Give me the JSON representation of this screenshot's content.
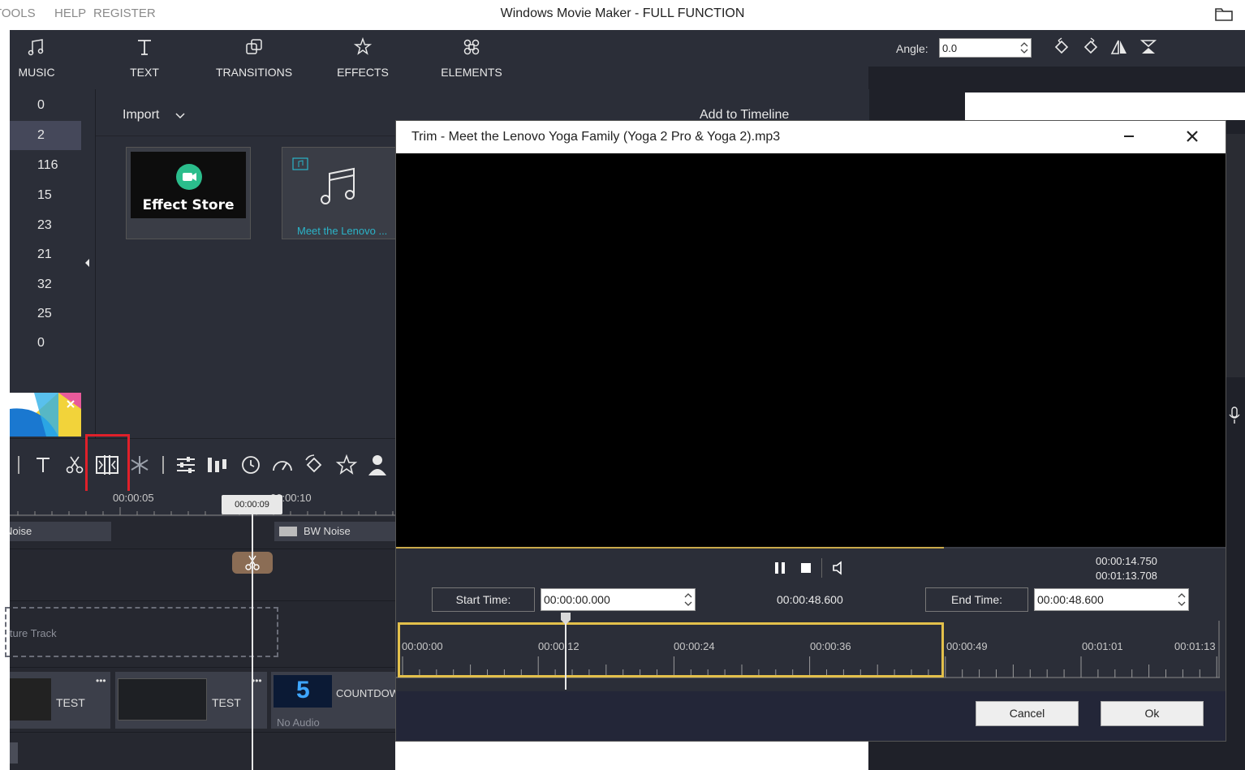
{
  "menu": {
    "tools": "TOOLS",
    "help": "HELP",
    "register": "REGISTER"
  },
  "app_title": "Windows Movie Maker - FULL FUNCTION",
  "toolbar": {
    "music": "MUSIC",
    "text": "TEXT",
    "transitions": "TRANSITIONS",
    "effects": "EFFECTS",
    "elements": "ELEMENTS"
  },
  "right_panel": {
    "angle_label": "Angle:",
    "angle_value": "0.0"
  },
  "sidebar_counts": [
    "0",
    "2",
    "116",
    "15",
    "23",
    "21",
    "32",
    "25",
    "0"
  ],
  "sidebar_selected_index": 1,
  "media": {
    "import_label": "Import",
    "add_to_timeline_label": "Add to Timeline",
    "effect_store_label": "Effect Store",
    "music_item_label": "Meet the Lenovo ..."
  },
  "timeline": {
    "ruler_labels": [
      "00:00:05",
      "00:00:10"
    ],
    "playhead_time": "00:00:09",
    "tracks": {
      "noise_left": "Noise",
      "bw_noise": "BW Noise",
      "pip_track": "Picture in Picture Track",
      "clip1": "TEST",
      "clip2": "TEST",
      "clip3": "COUNTDOWN",
      "clip3_audio": "No Audio"
    }
  },
  "trim_dialog": {
    "title": "Trim - Meet the Lenovo Yoga Family (Yoga 2 Pro & Yoga 2).mp3",
    "current_time": "00:00:14.750",
    "total_time": "00:01:13.708",
    "start_time_label": "Start Time:",
    "start_time_value": "00:00:00.000",
    "duration": "00:00:48.600",
    "end_time_label": "End Time:",
    "end_time_value": "00:00:48.600",
    "ruler_labels": [
      "00:00:00",
      "00:00:12",
      "00:00:24",
      "00:00:36",
      "00:00:49",
      "00:01:01",
      "00:01:13"
    ],
    "cancel_label": "Cancel",
    "ok_label": "Ok",
    "progress_fraction": 0.66
  },
  "colors": {
    "accent_selection": "#e3c04b",
    "highlight_box": "#e0202a",
    "panel": "#2b2e38"
  }
}
